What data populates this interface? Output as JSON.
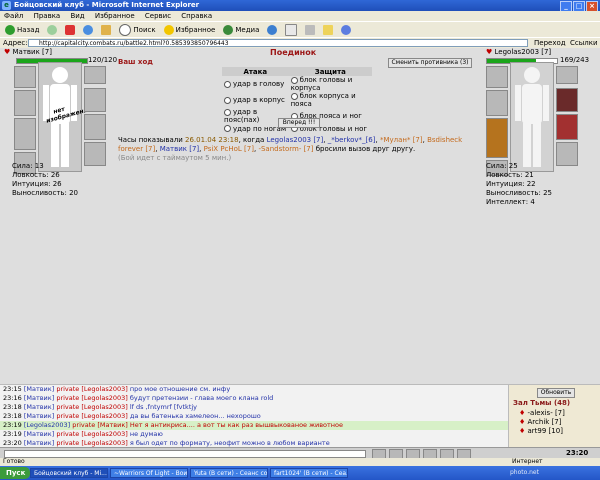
{
  "window": {
    "title": "Бойцовский клуб - Microsoft Internet Explorer"
  },
  "menu": [
    "Файл",
    "Правка",
    "Вид",
    "Избранное",
    "Сервис",
    "Справка"
  ],
  "toolbar": {
    "back": "Назад",
    "search": "Поиск",
    "favorites": "Избранное",
    "media": "Медиа"
  },
  "address": {
    "label": "Адрес:",
    "url": "http://capitalcity.combats.ru/battle2.html?0.585393850796443",
    "go": "Переход",
    "links": "Ссылки"
  },
  "battle": {
    "title": "Поединок",
    "your_turn": "Ваш ход",
    "change_opponent": "Сменить противника (3)",
    "attack_header": "Атака",
    "defense_header": "Защита",
    "attack_options": [
      "удар в голову",
      "удар в корпус",
      "удар в пояс(пах)",
      "удар по ногам"
    ],
    "defense_options": [
      "блок головы и корпуса",
      "блок корпуса и пояса",
      "блок пояса и ног",
      "блок головы и ног"
    ],
    "forward_button": "Вперед !!!",
    "log_line1_time": "Часы показывали",
    "log_line1_date": "26.01.04 23:18",
    "log_line1_rest": ", когда",
    "log_names": [
      "Legolas2003 [7]",
      "_*berkov*_[6]",
      "*Мулан*",
      "[7]",
      "Bsdisheck forever [7]",
      "Матвик [7]",
      "PsiX PcHoL [7]",
      "-Sandstorm- [7]"
    ],
    "log_tail": "бросили вызов друг другу.",
    "timeout_note": "(Бой идет с таймаутом 5 мин.)"
  },
  "player_left": {
    "name": "Матвик [7]",
    "hp": "120/120",
    "hp_fraction": 1.0,
    "no_image_text": "нет изображения",
    "stats": [
      {
        "label": "Сила: 13"
      },
      {
        "label": "Ловкость: 26"
      },
      {
        "label": "Интуиция: 26"
      },
      {
        "label": "Выносливость: 20"
      }
    ]
  },
  "player_right": {
    "name": "Legolas2003 [7]",
    "hp": "169/243",
    "hp_fraction": 0.7,
    "stats": [
      {
        "label": "Сила: 25"
      },
      {
        "label": "Ловкость: 21"
      },
      {
        "label": "Интуиция: 22"
      },
      {
        "label": "Выносливость: 25"
      },
      {
        "label": "Интеллект: 4"
      }
    ]
  },
  "chat": {
    "lines": [
      {
        "time": "23:15",
        "sender": "[Матвик]",
        "mode": "private",
        "target": "[Legolas2003]",
        "text": "про мое отношение см. инфу"
      },
      {
        "time": "23:16",
        "sender": "[Матвик]",
        "mode": "private",
        "target": "[Legolas2003]",
        "text": "будут претензии - глава моего клана rold"
      },
      {
        "time": "23:18",
        "sender": "[Матвик]",
        "mode": "private",
        "target": "[Legolas2003]",
        "text": "lf ds ,fntymrf [fvtktjy"
      },
      {
        "time": "23:18",
        "sender": "[Матвик]",
        "mode": "private",
        "target": "[Legolas2003]",
        "text": "да вы батенька хамелеон... нехорошо"
      },
      {
        "time": "23:19",
        "sender": "[Legolas2003]",
        "mode": "private",
        "target": "[Матвик]",
        "text": "Нет я антикриса.... а вот ты как раз вышвыкованое животное",
        "highlight": true
      },
      {
        "time": "23:19",
        "sender": "[Матвик]",
        "mode": "private",
        "target": "[Legolas2003]",
        "text": "не думаю"
      },
      {
        "time": "23:20",
        "sender": "[Матвик]",
        "mode": "private",
        "target": "[Legolas2003]",
        "text": "я был одет по формату, неофит можно в любом варианте"
      }
    ]
  },
  "online": {
    "refresh": "Обновить",
    "room": "Зал Тьмы (48)",
    "users": [
      "-alexis- [7]",
      "Archik [7]",
      "art99 [10]"
    ]
  },
  "status": {
    "left": "Готово",
    "right": "Интернет"
  },
  "taskbar": {
    "start": "Пуск",
    "tasks": [
      "Бойцовский клуб - Mi...",
      "~Warriors Of Light - Воин...",
      "Yuta (В сети) - Сеанс со...",
      "fart1024' (В сети) - Сеа..."
    ],
    "clock": "23:20"
  },
  "watermark": "photo.net"
}
